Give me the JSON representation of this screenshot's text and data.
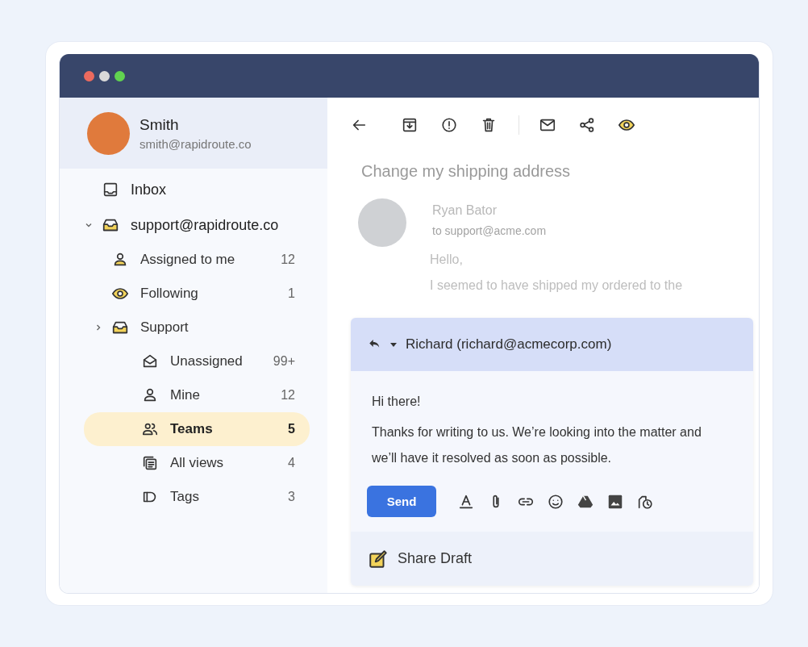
{
  "window": {
    "controls": [
      {
        "kind": "close"
      },
      {
        "kind": "minimize"
      },
      {
        "kind": "maximize"
      }
    ]
  },
  "sidebar": {
    "account": {
      "name": "Smith",
      "email": "smith@rapidroute.co"
    },
    "items": [
      {
        "label": "Inbox",
        "kind": "inbox",
        "selected": false
      },
      {
        "label": "support@rapidroute.co",
        "kind": "mailbox",
        "selected": false,
        "expanded": true,
        "children": [
          {
            "label": "Assigned to me",
            "kind": "person-fill",
            "count": "12",
            "selected": false
          },
          {
            "label": "Following",
            "kind": "eye",
            "count": "1",
            "selected": false
          },
          {
            "label": "Support",
            "kind": "mailbox",
            "selected": false,
            "expanded": false,
            "children": [
              {
                "label": "Unassigned",
                "kind": "envelope",
                "count": "99+",
                "selected": false
              },
              {
                "label": "Mine",
                "kind": "person",
                "count": "12",
                "selected": false
              },
              {
                "label": "Teams",
                "kind": "people",
                "count": "5",
                "selected": true
              },
              {
                "label": "All views",
                "kind": "views",
                "count": "4",
                "selected": false
              },
              {
                "label": "Tags",
                "kind": "tag",
                "count": "3",
                "selected": false
              }
            ]
          }
        ]
      }
    ]
  },
  "toolbar": [
    {
      "kind": "back"
    },
    {
      "kind": "archive"
    },
    {
      "kind": "alert"
    },
    {
      "kind": "trash"
    },
    {
      "kind": "divider"
    },
    {
      "kind": "mail"
    },
    {
      "kind": "share"
    },
    {
      "kind": "eye"
    }
  ],
  "message": {
    "subject": "Change my shipping address",
    "sender": "Ryan Bator",
    "to": "to support@acme.com",
    "body": [
      "Hello,",
      "I seemed to have shipped my ordered to the"
    ]
  },
  "reply": {
    "recipient": "Richard (richard@acmecorp.com)",
    "body": [
      "Hi there!",
      "Thanks for writing to us. We’re looking into the matter and we’ll have it resolved as soon as possible."
    ],
    "send": "Send",
    "tools": [
      {
        "kind": "text-color"
      },
      {
        "kind": "attach"
      },
      {
        "kind": "link"
      },
      {
        "kind": "emoji"
      },
      {
        "kind": "drive"
      },
      {
        "kind": "image"
      },
      {
        "kind": "schedule"
      }
    ],
    "share_draft": "Share Draft"
  }
}
